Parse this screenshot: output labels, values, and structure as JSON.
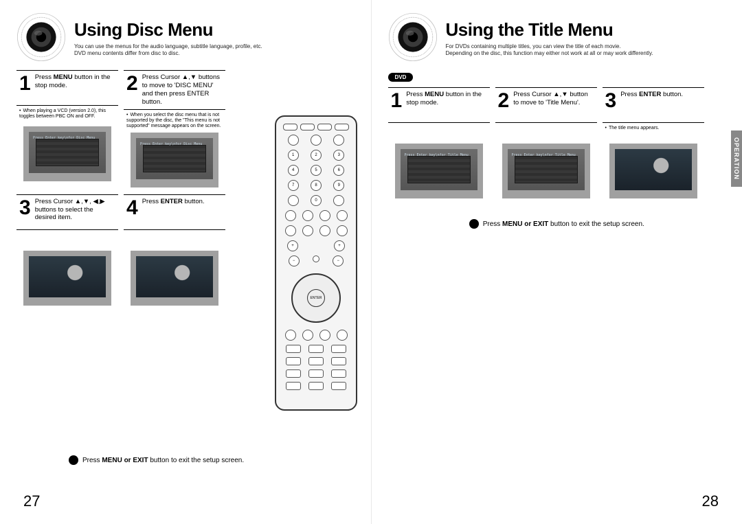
{
  "left": {
    "title": "Using Disc Menu",
    "subtitle_line1": "You can use the menus for the audio language, subtitle language, profile, etc.",
    "subtitle_line2": "DVD menu contents differ from disc to disc.",
    "step1": {
      "num": "1",
      "text_pre": "Press ",
      "text_bold": "MENU",
      "text_post": " button in the stop mode.",
      "note": "When playing a VCD (version 2.0), this toggles between PBC ON and OFF."
    },
    "step2": {
      "num": "2",
      "text": "Press Cursor ▲,▼ buttons to move to 'DISC MENU' and then press ENTER button.",
      "note": "When you select the disc menu that is not supported by the disc, the \"This menu is not supported\" message appears on the screen."
    },
    "step3": {
      "num": "3",
      "text": "Press Cursor ▲,▼, ◀,▶ buttons to select the desired item."
    },
    "step4": {
      "num": "4",
      "text_pre": "Press ",
      "text_bold": "ENTER",
      "text_post": " button."
    },
    "exit_text_pre": "Press ",
    "exit_text_bold": "MENU or EXIT",
    "exit_text_post": " button to exit the setup screen.",
    "pagenum": "27"
  },
  "right": {
    "title": "Using the Title Menu",
    "subtitle_line1": "For DVDs containing multiple titles, you can view the title of each movie.",
    "subtitle_line2": "Depending on the disc, this function may either not work at all or may work differently.",
    "badge": "DVD",
    "step1": {
      "num": "1",
      "text_pre": "Press ",
      "text_bold": "MENU",
      "text_post": " button in the stop mode."
    },
    "step2": {
      "num": "2",
      "text": "Press Cursor ▲,▼ button to move to 'Title Menu'."
    },
    "step3": {
      "num": "3",
      "text_pre": "Press ",
      "text_bold": "ENTER",
      "text_post": " button.",
      "note": "The title menu appears."
    },
    "exit_text_pre": "Press ",
    "exit_text_bold": "MENU or EXIT",
    "exit_text_post": " button to exit the setup screen.",
    "pagenum": "28",
    "side_tab": "OPERATION"
  }
}
